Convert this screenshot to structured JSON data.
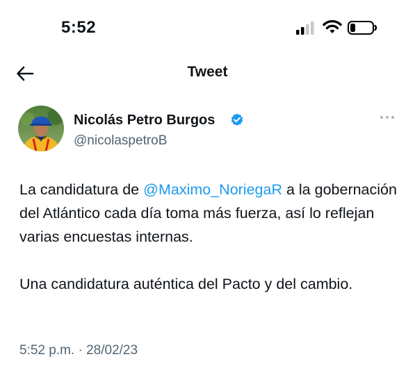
{
  "status_bar": {
    "time": "5:52"
  },
  "header": {
    "title": "Tweet"
  },
  "tweet": {
    "author": {
      "display_name": "Nicolás Petro Burgos",
      "handle": "@nicolaspetroB"
    },
    "text_part1": "La candidatura de ",
    "mention": "@Maximo_NoriegaR",
    "text_part2": " a la gobernación del Atlántico cada día toma más fuerza, así lo reflejan varias encuestas internas.",
    "paragraph2": "Una candidatura auténtica del Pacto y del cambio.",
    "timestamp": "5:52 p.m. · 28/02/23"
  },
  "colors": {
    "accent": "#1d9bf0",
    "text": "#0f1419",
    "muted": "#536471"
  }
}
